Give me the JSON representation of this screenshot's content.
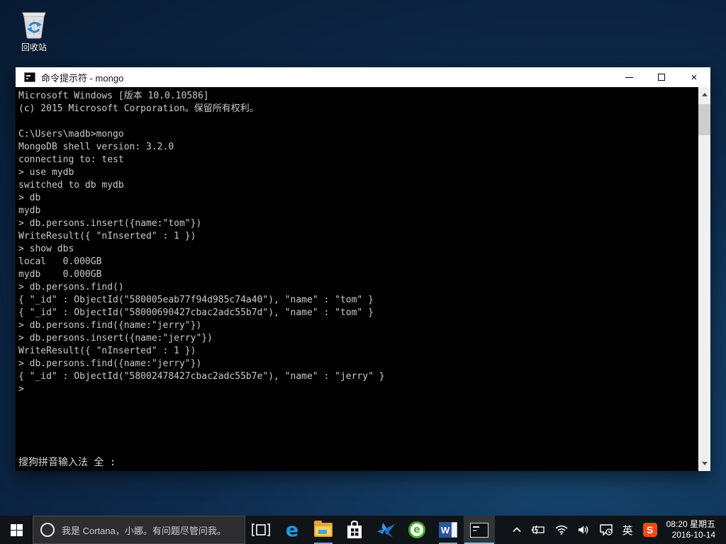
{
  "desktop": {
    "recycle_bin_label": "回收站"
  },
  "window": {
    "title": "命令提示符 - mongo",
    "console": {
      "lines": [
        "Microsoft Windows [版本 10.0.10586]",
        "(c) 2015 Microsoft Corporation。保留所有权利。",
        " ",
        "C:\\Users\\madb>mongo",
        "MongoDB shell version: 3.2.0",
        "connecting to: test",
        "> use mydb",
        "switched to db mydb",
        "> db",
        "mydb",
        "> db.persons.insert({name:\"tom\"})",
        "WriteResult({ \"nInserted\" : 1 })",
        "> show dbs",
        "local   0.000GB",
        "mydb    0.000GB",
        "> db.persons.find()",
        "{ \"_id\" : ObjectId(\"580005eab77f94d985c74a40\"), \"name\" : \"tom\" }",
        "{ \"_id\" : ObjectId(\"58000690427cbac2adc55b7d\"), \"name\" : \"tom\" }",
        "> db.persons.find({name:\"jerry\"})",
        "> db.persons.insert({name:\"jerry\"})",
        "WriteResult({ \"nInserted\" : 1 })",
        "> db.persons.find({name:\"jerry\"})",
        "{ \"_id\" : ObjectId(\"58002478427cbac2adc55b7e\"), \"name\" : \"jerry\" }",
        ">"
      ],
      "ime_status": "搜狗拼音输入法 全 :"
    }
  },
  "taskbar": {
    "search_text": "我是 Cortana，小娜。有问题尽管问我。",
    "apps": [
      "task-view",
      "edge",
      "file-explorer",
      "store",
      "xunlei-bird",
      "green-e-browser",
      "word",
      "cmd"
    ],
    "icons": {
      "edge": "e",
      "green_browser": "e",
      "word": "W",
      "sogou": "S",
      "close": "×"
    },
    "tray": {
      "ime_label": "英",
      "time": "08:20 星期五",
      "date": "2016-10-14"
    }
  }
}
